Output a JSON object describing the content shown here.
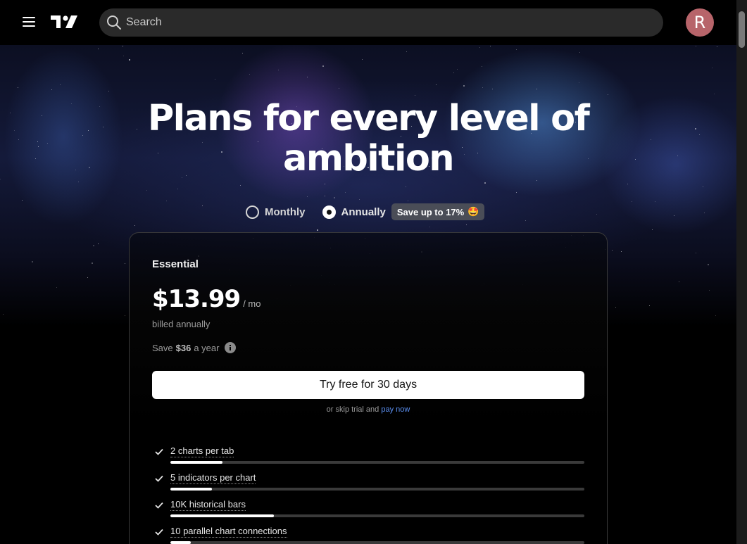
{
  "search": {
    "placeholder": "Search"
  },
  "user": {
    "avatar_letter": "R",
    "avatar_color": "#b7646a"
  },
  "hero": {
    "title": "Plans for every level of ambition"
  },
  "billing": {
    "monthly_label": "Monthly",
    "annual_label": "Annually",
    "selected": "Annually",
    "save_badge": "Save up to 17%",
    "save_emoji": "🤩"
  },
  "plan": {
    "name": "Essential",
    "price": "$13.99",
    "period": "/ mo",
    "billed": "billed annually",
    "save_prefix": "Save",
    "save_amount": "$36",
    "save_suffix": "a year",
    "cta_label": "Try free for 30 days",
    "skip_text": "or skip trial and",
    "skip_link": "pay now",
    "features": [
      {
        "label": "2 charts per tab",
        "level": 0.126
      },
      {
        "label": "5 indicators per chart",
        "level": 0.1
      },
      {
        "label": "10K historical bars",
        "level": 0.25
      },
      {
        "label": "10 parallel chart connections",
        "level": 0.05
      }
    ]
  },
  "colors": {
    "link": "#5b8ff0",
    "button_bg": "#ffffff",
    "badge_bg": "#4a4d57"
  }
}
